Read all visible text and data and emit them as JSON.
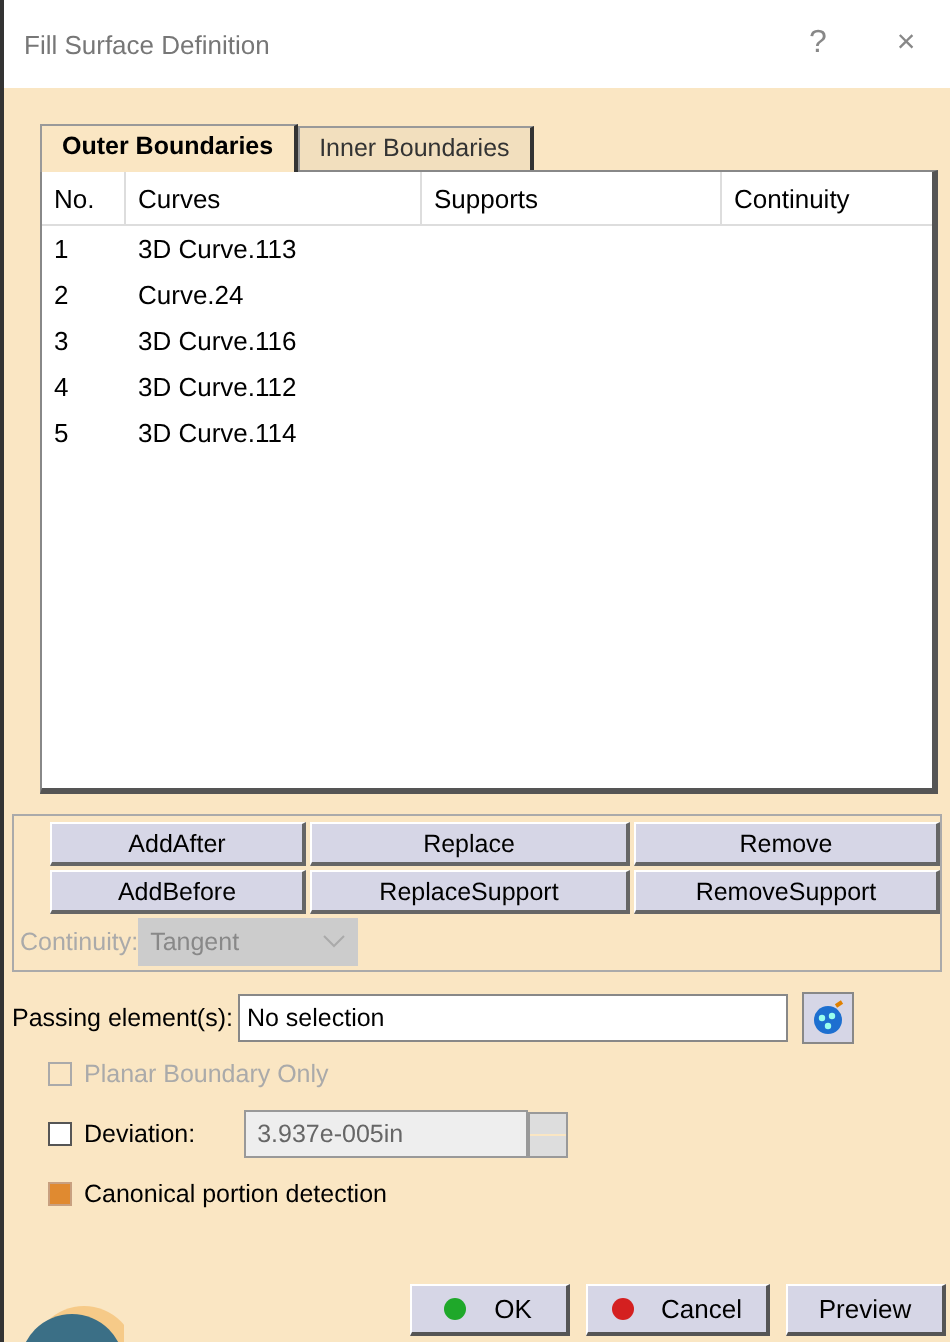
{
  "window": {
    "title": "Fill Surface Definition",
    "help": "?",
    "close": "×"
  },
  "tabs": [
    {
      "label": "Outer Boundaries",
      "selected": true
    },
    {
      "label": "Inner Boundaries",
      "selected": false
    }
  ],
  "table": {
    "columns": [
      "No.",
      "Curves",
      "Supports",
      "Continuity"
    ],
    "rows": [
      {
        "no": "1",
        "curve": "3D Curve.113"
      },
      {
        "no": "2",
        "curve": "Curve.24"
      },
      {
        "no": "3",
        "curve": "3D Curve.116"
      },
      {
        "no": "4",
        "curve": "3D Curve.112"
      },
      {
        "no": "5",
        "curve": "3D Curve.114"
      }
    ]
  },
  "actions": [
    "AddAfter",
    "Replace",
    "Remove",
    "AddBefore",
    "ReplaceSupport",
    "RemoveSupport"
  ],
  "continuity": {
    "label": "Continuity:",
    "value": "Tangent",
    "disabled": true
  },
  "passing": {
    "label": "Passing element(s):",
    "value": "No selection"
  },
  "options": [
    {
      "kind": "check",
      "label": "Planar Boundary Only",
      "checked": false,
      "disabled": true
    },
    {
      "kind": "spin",
      "label": "Deviation:",
      "checked": false,
      "disabled": false,
      "value": "3.937e-005in"
    },
    {
      "kind": "check",
      "label": "Canonical portion detection",
      "checked": true,
      "disabled": false
    }
  ],
  "buttons": [
    {
      "label": "OK",
      "kind": "ok"
    },
    {
      "label": "Cancel",
      "kind": "cancel"
    },
    {
      "label": "Preview",
      "kind": "plain"
    }
  ]
}
